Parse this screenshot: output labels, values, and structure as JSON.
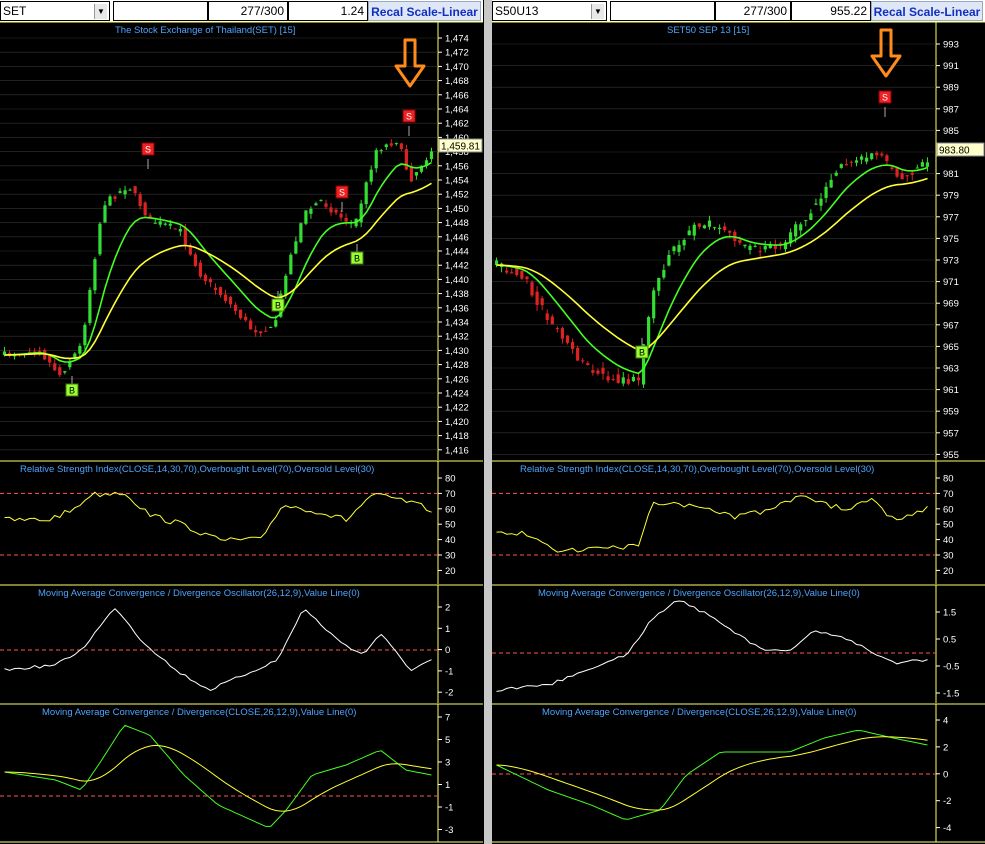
{
  "left": {
    "symbol": "SET",
    "counter": "277/300",
    "value": "1.24",
    "recal_label": "Recal Scale-Linear",
    "price_title": "The Stock Exchange of Thailand(SET) [15]",
    "price_ticks": [
      "1,474",
      "1,472",
      "1,470",
      "1,468",
      "1,466",
      "1,464",
      "1,462",
      "1,460",
      "1,458",
      "1,456",
      "1,454",
      "1,452",
      "1,450",
      "1,448",
      "1,446",
      "1,444",
      "1,442",
      "1,440",
      "1,438",
      "1,436",
      "1,434",
      "1,432",
      "1,430",
      "1,428",
      "1,426",
      "1,424",
      "1,422",
      "1,420",
      "1,418",
      "1,416"
    ],
    "last_price": "1,459.81",
    "signals": [
      {
        "t": "S"
      },
      {
        "t": "S"
      },
      {
        "t": "S"
      },
      {
        "t": "B"
      },
      {
        "t": "B"
      },
      {
        "t": "B"
      }
    ],
    "rsi_title": "Relative Strength Index(CLOSE,14,30,70),Overbought Level(70),Oversold Level(30)",
    "rsi_ticks": [
      "80",
      "70",
      "60",
      "50",
      "40",
      "30",
      "20"
    ],
    "macdosc_title": "Moving Average Convergence / Divergence Oscillator(26,12,9),Value Line(0)",
    "macdosc_ticks": [
      "2",
      "1",
      "0",
      "-1",
      "-2"
    ],
    "macd_title": "Moving Average Convergence / Divergence(CLOSE,26,12,9),Value Line(0)",
    "macd_ticks": [
      "7",
      "5",
      "3",
      "1",
      "-1",
      "-3"
    ]
  },
  "right": {
    "symbol": "S50U13",
    "counter": "277/300",
    "value": "955.22",
    "recal_label": "Recal Scale-Linear",
    "price_title": "SET50 SEP 13   [15]",
    "price_ticks": [
      "993",
      "991",
      "989",
      "987",
      "985",
      "983",
      "981",
      "979",
      "977",
      "975",
      "973",
      "971",
      "969",
      "967",
      "965",
      "963",
      "961",
      "959",
      "957",
      "955"
    ],
    "last_price": "983.80",
    "signals": [
      {
        "t": "S"
      },
      {
        "t": "B"
      }
    ],
    "rsi_title": "Relative Strength Index(CLOSE,14,30,70),Overbought Level(70),Oversold Level(30)",
    "rsi_ticks": [
      "80",
      "70",
      "60",
      "50",
      "40",
      "30",
      "20"
    ],
    "macdosc_title": "Moving Average Convergence / Divergence Oscillator(26,12,9),Value Line(0)",
    "macdosc_ticks": [
      "1.5",
      "0.5",
      "-0.5",
      "-1.5"
    ],
    "macd_title": "Moving Average Convergence / Divergence(CLOSE,26,12,9),Value Line(0)",
    "macd_ticks": [
      "4",
      "2",
      "0",
      "-2",
      "-4"
    ]
  },
  "colors": {
    "up": "#33dd33",
    "down": "#dd2222",
    "fast_ma": "#44ff22",
    "slow_ma": "#ffff33",
    "panel_border": "#ffff66",
    "grid": "#333333",
    "level": "#ff5555",
    "buy": "#99ff33",
    "sell": "#ee2222",
    "arrow": "#ff8c1a",
    "title": "#4da3ff"
  }
}
